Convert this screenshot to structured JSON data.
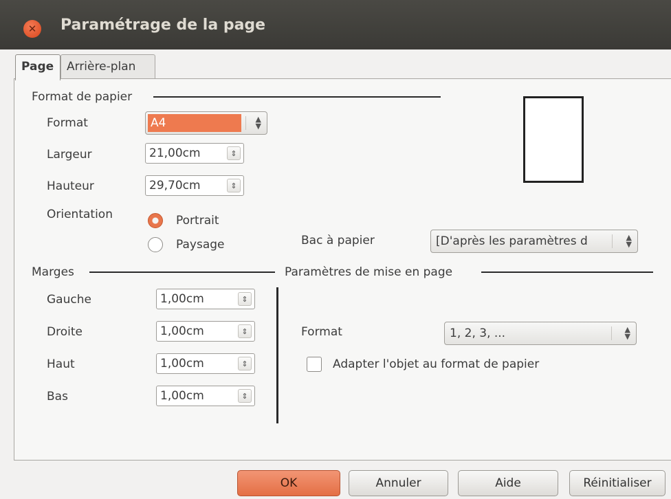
{
  "window": {
    "title": "Paramétrage de la page",
    "close_icon": "close-icon"
  },
  "tabs": [
    {
      "label": "Page",
      "active": true
    },
    {
      "label": "Arrière-plan",
      "active": false
    }
  ],
  "paper_format": {
    "section_label": "Format de papier",
    "format_label": "Format",
    "format_value": "A4",
    "width_label": "Largeur",
    "width_value": "21,00cm",
    "height_label": "Hauteur",
    "height_value": "29,70cm",
    "orientation_label": "Orientation",
    "portrait_label": "Portrait",
    "landscape_label": "Paysage",
    "selected_orientation": "Portrait",
    "tray_label": "Bac à papier",
    "tray_value": "[D'après les paramètres d"
  },
  "margins": {
    "section_label": "Marges",
    "left_label": "Gauche",
    "left_value": "1,00cm",
    "right_label": "Droite",
    "right_value": "1,00cm",
    "top_label": "Haut",
    "top_value": "1,00cm",
    "bottom_label": "Bas",
    "bottom_value": "1,00cm"
  },
  "layout_settings": {
    "section_label": "Paramètres de mise en page",
    "format_label": "Format",
    "format_value": "1, 2, 3, ...",
    "fit_object_label": "Adapter l'objet au format de papier",
    "fit_object_checked": false
  },
  "buttons": {
    "ok": "OK",
    "cancel": "Annuler",
    "help": "Aide",
    "reset": "Réinitialiser"
  },
  "colors": {
    "accent": "#e46f45",
    "titlebar": "#3f3e3a"
  }
}
